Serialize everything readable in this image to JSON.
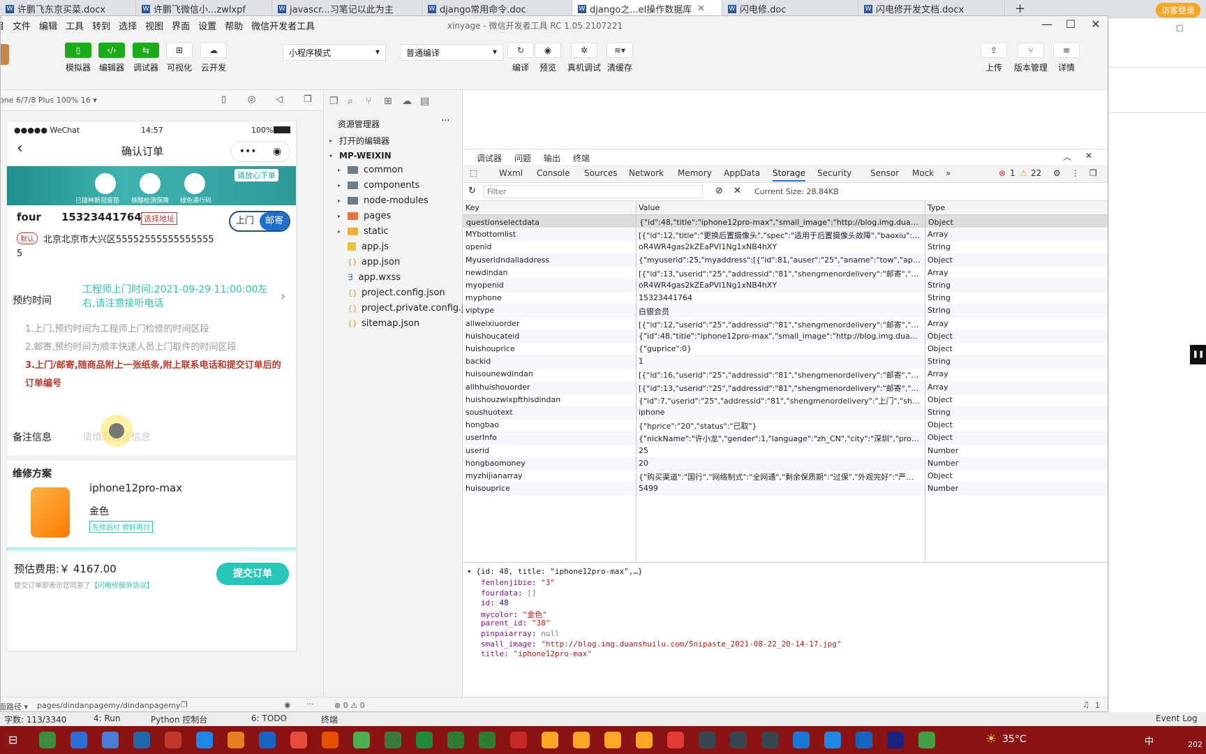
{
  "doctabs": [
    {
      "label": "许鹏飞东京买菜.docx",
      "active": false
    },
    {
      "label": "许鹏飞微信小...zwlxpf",
      "active": false
    },
    {
      "label": "javascr...习笔记以此为主",
      "active": false
    },
    {
      "label": "django常用命令.doc",
      "active": false
    },
    {
      "label": "django之...el操作数据库",
      "active": true
    },
    {
      "label": "闪电修.doc",
      "active": false
    },
    {
      "label": "闪电修开发文档.docx",
      "active": false
    }
  ],
  "visitor_login": "访客登录",
  "window": {
    "title": "xinyage - 微信开发者工具 RC 1.05.2107221",
    "menus": [
      "目",
      "文件",
      "编辑",
      "工具",
      "转到",
      "选择",
      "视图",
      "界面",
      "设置",
      "帮助",
      "微信开发者工具"
    ]
  },
  "toolbar": {
    "simulator": "模拟器",
    "editor": "编辑器",
    "debugger": "调试器",
    "visual": "可视化",
    "cloud": "云开发",
    "mode_select": "小程序模式",
    "compile_select": "普通编译",
    "compile": "编译",
    "preview": "预览",
    "real_debug": "真机调试",
    "clear_cache": "清缓存",
    "upload": "上传",
    "version": "版本管理",
    "details": "详情"
  },
  "sim": {
    "device": "one 6/7/8 Plus 100% 16 ▾",
    "status_carrier": "●●●●● WeChat",
    "status_time": "14:57",
    "status_battery": "100%",
    "nav_title": "确认订单",
    "banner_tag": "请放心下单",
    "banner_items": [
      "已接种新冠疫苗",
      "核酸检测保障",
      "绿色通行码"
    ],
    "user_name": "four",
    "user_phone": "15323441764",
    "choose_address": "选择地址",
    "toggle_door": "上门",
    "toggle_mail": "邮寄",
    "default_tag": "默认",
    "address_line1": "北京北京市大兴区55552555555555555",
    "address_line2": "5",
    "appt_label": "预约时间",
    "appt_value_1": "工程师上门时间:2021-09-29 11:00:00左",
    "appt_value_2": "右,请注意接听电话",
    "note1": "1.上门,预约时间为工程师上门检修的时间区段",
    "note2": "2.邮寄,预约时间为顺丰快递人员上门取件的时间区段",
    "note3_1": "3.上门/邮寄,随商品附上一张纸条,附上联系电话和提交订单后的",
    "note3_2": "订单编号",
    "remark_label": "备注信息",
    "remark_placeholder": "请填写备注信息",
    "plan_title": "维修方案",
    "product_name": "iphone12pro-max",
    "product_color": "金色",
    "product_tag": "先修后付 修好再付",
    "price_label": "预估费用:￥ 4167.00",
    "agreement_prefix": "提交订单即表示您同意了",
    "agreement_link": "【闪电修服务协议】",
    "submit": "提交订单"
  },
  "explorer": {
    "title": "资源管理器",
    "open_editors": "打开的编辑器",
    "root": "MP-WEIXIN",
    "items": [
      {
        "name": "common",
        "type": "folder"
      },
      {
        "name": "components",
        "type": "folder"
      },
      {
        "name": "node-modules",
        "type": "folder"
      },
      {
        "name": "pages",
        "type": "folder"
      },
      {
        "name": "static",
        "type": "folder"
      },
      {
        "name": "app.js",
        "type": "js"
      },
      {
        "name": "app.json",
        "type": "json"
      },
      {
        "name": "app.wxss",
        "type": "wxss"
      },
      {
        "name": "project.config.json",
        "type": "json"
      },
      {
        "name": "project.private.config.js...",
        "type": "json"
      },
      {
        "name": "sitemap.json",
        "type": "json"
      }
    ]
  },
  "devtools": {
    "top_tabs": [
      "调试器",
      "问题",
      "输出",
      "终端"
    ],
    "panel_tabs": [
      "Wxml",
      "Console",
      "Sources",
      "Network",
      "Memory",
      "AppData",
      "Storage",
      "Security",
      "Sensor",
      "Mock"
    ],
    "errors": "1",
    "warnings": "22",
    "filter_placeholder": "Filter",
    "current_size": "Current Size: 28.84KB",
    "columns": [
      "Key",
      "Value",
      "Type"
    ],
    "rows": [
      {
        "key": "questionselectdata",
        "value": "{\"id\":48,\"title\":\"iphone12pro-max\",\"small_image\":\"http://blog.img.duanshuilu.com/...",
        "type": "Object"
      },
      {
        "key": "MYbottomlist",
        "value": "[{\"id\":12,\"title\":\"更换后置摄像头\",\"spec\":\"适用于后置摄像头故障\",\"baoxiu\":\"180天\",\"...",
        "type": "Array"
      },
      {
        "key": "openid",
        "value": "oR4WR4gas2kZEaPVI1Ng1xNB4hXY",
        "type": "String"
      },
      {
        "key": "Myuseridndalladdress",
        "value": "{\"myuserid\":25,\"myaddress\":[{\"id\":81,\"auser\":\"25\",\"aname\":\"tow\",\"aphone\":\"153234...",
        "type": "Object"
      },
      {
        "key": "newdindan",
        "value": "[{\"id\":13,\"userid\":\"25\",\"addressid\":\"81\",\"shengmenordelivery\":\"邮寄\",\"shengtime\":\"2...",
        "type": "Array"
      },
      {
        "key": "myopenid",
        "value": "oR4WR4gas2kZEaPVI1Ng1xNB4hXY",
        "type": "String"
      },
      {
        "key": "myphone",
        "value": "15323441764",
        "type": "String"
      },
      {
        "key": "viptype",
        "value": "白银会员",
        "type": "String"
      },
      {
        "key": "allweixiuorder",
        "value": "[{\"id\":12,\"userid\":\"25\",\"addressid\":\"81\",\"shengmenordelivery\":\"邮寄\",\"shengtime\":\"2...",
        "type": "Array"
      },
      {
        "key": "huishoucateid",
        "value": "{\"id\":48,\"title\":\"iphone12pro-max\",\"small_image\":\"http://blog.img.duanshuilu.com/...",
        "type": "Object"
      },
      {
        "key": "huishouprice",
        "value": "{\"guprice\":0}",
        "type": "Object"
      },
      {
        "key": "backid",
        "value": "1",
        "type": "String"
      },
      {
        "key": "huisounewdindan",
        "value": "[{\"id\":16,\"userid\":\"25\",\"addressid\":\"81\",\"shengmenordelivery\":\"邮寄\",\"shengtime\":\"2...",
        "type": "Array"
      },
      {
        "key": "allhhuishouorder",
        "value": "[{\"id\":13,\"userid\":\"25\",\"addressid\":\"81\",\"shengmenordelivery\":\"邮寄\",\"shengtime\":\"2...",
        "type": "Array"
      },
      {
        "key": "huishouzwlxpfthisdindan",
        "value": "{\"id\":7,\"userid\":\"25\",\"addressid\":\"81\",\"shengmenordelivery\":\"上门\",\"shengtime\":\"20...",
        "type": "Object"
      },
      {
        "key": "soushuotext",
        "value": "iphone",
        "type": "String"
      },
      {
        "key": "hongbao",
        "value": "{\"hprice\":\"20\",\"status\":\"已取\"}",
        "type": "Object"
      },
      {
        "key": "userInfo",
        "value": "{\"nickName\":\"许小龙\",\"gender\":1,\"language\":\"zh_CN\",\"city\":\"深圳\",\"province\":\"广东...",
        "type": "Object"
      },
      {
        "key": "userid",
        "value": "25",
        "type": "Number"
      },
      {
        "key": "hongbaomoney",
        "value": "20",
        "type": "Number"
      },
      {
        "key": "myzhijianarray",
        "value": "{\"购买渠道\":\"国行\",\"网络制式\":\"全网通\",\"剩余保质期\":\"过保\",\"外观完好\":\"严重损伤\",...",
        "type": "Object"
      },
      {
        "key": "huisouprice",
        "value": "5499",
        "type": "Number"
      }
    ],
    "detail_header": "▾ {id: 48, title: \"iphone12pro-max\",…}",
    "detail": [
      {
        "k": "fenlenjibie",
        "v": "\"3\"",
        "t": "str"
      },
      {
        "k": "fourdata",
        "v": "[]",
        "t": "nul"
      },
      {
        "k": "id",
        "v": "48",
        "t": "num"
      },
      {
        "k": "mycolor",
        "v": "\"金色\"",
        "t": "str"
      },
      {
        "k": "parent_id",
        "v": "\"38\"",
        "t": "str"
      },
      {
        "k": "pinpaiarray",
        "v": "null",
        "t": "nul"
      },
      {
        "k": "small_image",
        "v": "\"http://blog.img.duanshuilu.com/Snipaste_2021-08-22_20-14-17.jpg\"",
        "t": "str"
      },
      {
        "k": "title",
        "v": "\"iphone12pro-max\"",
        "t": "str"
      }
    ]
  },
  "statusbar": {
    "path_label": "页面路径 ▾",
    "path": "pages/dindanpagemy/dindanpagemy",
    "errs": "⊗ 0 ⚠ 0",
    "notif": "1"
  },
  "bgstrip": {
    "words": "字数: 113/3340",
    "run": "4: Run",
    "python": "Python 控制台",
    "todo": "6: TODO",
    "terminal": "终端",
    "eventlog": "Event Log"
  },
  "taskbar": {
    "weather": "35°C",
    "ime": "中",
    "clock": "202"
  },
  "colors": {
    "accent_teal": "#26c6b8",
    "green": "#1aad19",
    "taskbar": "#8a1414",
    "red_note": "#c0392b"
  }
}
